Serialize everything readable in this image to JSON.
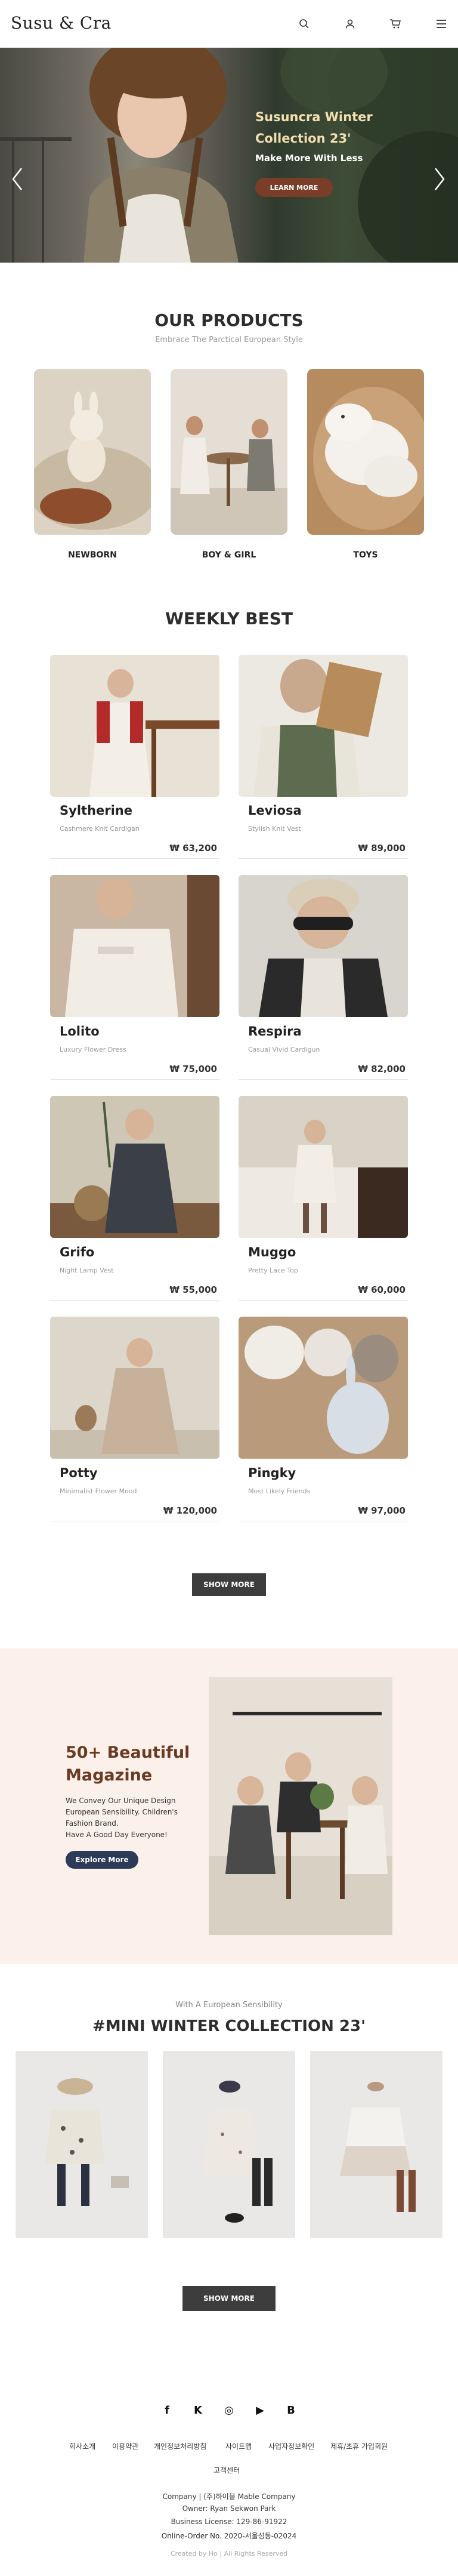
{
  "header": {
    "logo": "Susu & Cra",
    "icons": [
      "search-icon",
      "user-icon",
      "cart-icon",
      "menu-icon"
    ]
  },
  "hero": {
    "title": "Susuncra Winter Collection 23'",
    "subtitle": "Make More With Less",
    "button": "LEARN MORE",
    "colors": {
      "title": "#f2dfae",
      "button": "#7a3e28"
    }
  },
  "products": {
    "title": "OUR PRODUCTS",
    "subtitle": "Embrace The Parctical European Style",
    "categories": [
      {
        "label": "NEWBORN"
      },
      {
        "label": "BOY & GIRL"
      },
      {
        "label": "TOYS"
      }
    ]
  },
  "weekly": {
    "title": "WEEKLY BEST",
    "items": [
      {
        "name": "Syltherine",
        "desc": "Cashmere Knit Cardigan",
        "price": "₩ 63,200"
      },
      {
        "name": "Leviosa",
        "desc": "Stylish Knit Vest",
        "price": "₩ 89,000"
      },
      {
        "name": "Lolito",
        "desc": "Luxury Flower Dress",
        "price": "₩ 75,000"
      },
      {
        "name": "Respira",
        "desc": "Casual Vivid Cardigun",
        "price": "₩ 82,000"
      },
      {
        "name": "Grifo",
        "desc": "Night Lamp Vest",
        "price": "₩ 55,000"
      },
      {
        "name": "Muggo",
        "desc": "Pretty Lace Top",
        "price": "₩ 60,000"
      },
      {
        "name": "Potty",
        "desc": "Minimalist Flower Mood",
        "price": "₩ 120,000"
      },
      {
        "name": "Pingky",
        "desc": "Most Likely Friends",
        "price": "₩ 97,000"
      }
    ],
    "show_more": "SHOW MORE"
  },
  "magazine": {
    "title": "50+ Beautiful Magazine",
    "lines": [
      "We Convey Our Unique Design",
      "European Sensibility. Children's",
      "Fashion Brand.",
      "Have A Good Day Everyone!"
    ],
    "button": "Explore More",
    "colors": {
      "background": "#fcf1ea",
      "title": "#6b3a22",
      "button": "#2c3b57"
    }
  },
  "mini": {
    "eyebrow": "With A European Sensibility",
    "title": "#MINI WINTER COLLECTION 23'",
    "show_more": "SHOW MORE"
  },
  "footer": {
    "social": [
      "facebook-icon",
      "kakao-icon",
      "instagram-icon",
      "youtube-icon",
      "blog-icon"
    ],
    "social_glyphs": [
      "f",
      "K",
      "◎",
      "▶",
      "B"
    ],
    "links": [
      "회사소개",
      "이용약관",
      "개인정보처리방침",
      "사이트맵",
      "사업자정보확인",
      "제휴/초휴 가입회원",
      "고객센터"
    ],
    "company": "Company | (주)하이블 Mable Company",
    "owner": "Owner: Ryan Sekwon Park",
    "license": "Business License: 129-86-91922",
    "order": "Online-Order No. 2020-서울성동-02024",
    "copyright": "Created by Ho | All Rights Reserved"
  }
}
